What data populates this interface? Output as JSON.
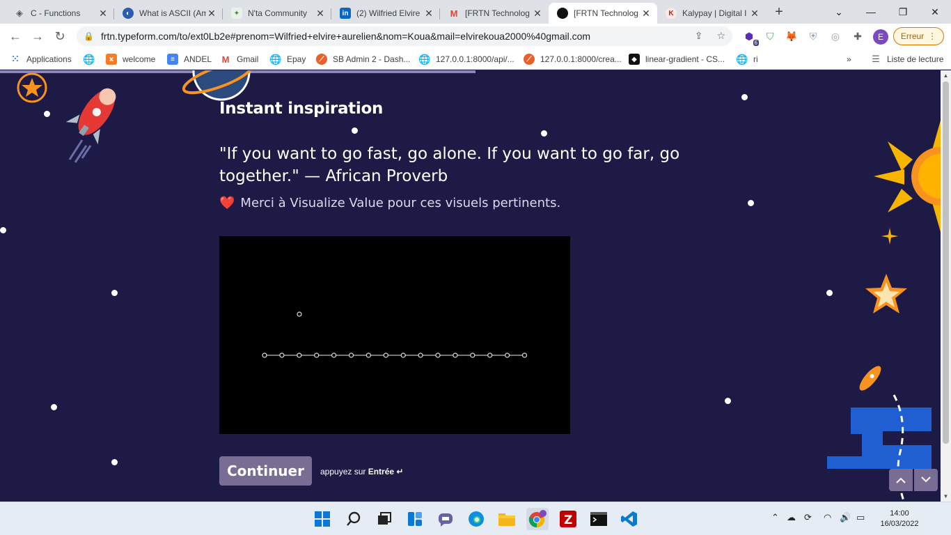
{
  "tabs": [
    {
      "title": "C - Functions",
      "icon": "diamond-icon",
      "color": "#555555"
    },
    {
      "title": "What is ASCII (American",
      "icon": "globe-icon",
      "color": "#2a5cae"
    },
    {
      "title": "N'ta Community",
      "icon": "nta-icon",
      "color": "#3c8c3c"
    },
    {
      "title": "(2) Wilfried Elvire",
      "icon": "linkedin-icon",
      "color": "#0a66c2"
    },
    {
      "title": "[FRTN Technolog",
      "icon": "gmail-icon",
      "color": "#ea4335"
    },
    {
      "title": "[FRTN Technolog",
      "icon": "typeform-icon",
      "color": "#111111"
    },
    {
      "title": "Kalypay | Digital I",
      "icon": "kalypay-icon",
      "color": "#b3261e"
    }
  ],
  "address": {
    "url": "frtn.typeform.com/to/ext0Lb2e#prenom=Wilfried+elvire+aurelien&nom=Koua&mail=elvirekoua2000%40gmail.com",
    "error_label": "Erreur",
    "profile_initial": "E",
    "ext_badge": "6"
  },
  "bookmarks": [
    {
      "label": "Applications",
      "icon": "apps-grid-icon",
      "color": "#4285f4"
    },
    {
      "label": "",
      "icon": "globe-icon",
      "color": "#5f6368"
    },
    {
      "label": "welcome",
      "icon": "xampp-icon",
      "color": "#fb7a24"
    },
    {
      "label": "ANDEL",
      "icon": "docs-icon",
      "color": "#4285f4"
    },
    {
      "label": "Gmail",
      "icon": "gmail-icon",
      "color": "#ea4335"
    },
    {
      "label": "Epay",
      "icon": "globe-icon",
      "color": "#5f6368"
    },
    {
      "label": "SB Admin 2 - Dash...",
      "icon": "sb-icon",
      "color": "#e8612c"
    },
    {
      "label": "127.0.0.1:8000/api/...",
      "icon": "globe-icon",
      "color": "#5f6368"
    },
    {
      "label": "127.0.0.1:8000/crea...",
      "icon": "sb-icon",
      "color": "#e8612c"
    },
    {
      "label": "linear-gradient - CS...",
      "icon": "codepen-icon",
      "color": "#111111"
    },
    {
      "label": "ri",
      "icon": "globe-icon",
      "color": "#5f6368"
    }
  ],
  "reading_list": "Liste de lecture",
  "page": {
    "progress": 0.5,
    "heading": "Instant inspiration",
    "quote": "\"If you want to go fast, go alone. If you want to go far, go together.\" — African Proverb",
    "thanks_emoji": "❤️",
    "thanks": "Merci à Visualize Value pour ces visuels pertinents.",
    "continue_label": "Continuer",
    "hint_prefix": "appuyez sur ",
    "hint_key": "Entrée ↵"
  },
  "clock": {
    "time": "14:00",
    "date": "16/03/2022"
  },
  "colors": {
    "background": "#1e1a46",
    "button": "#7a6d94",
    "accent_orange": "#f7931e"
  }
}
